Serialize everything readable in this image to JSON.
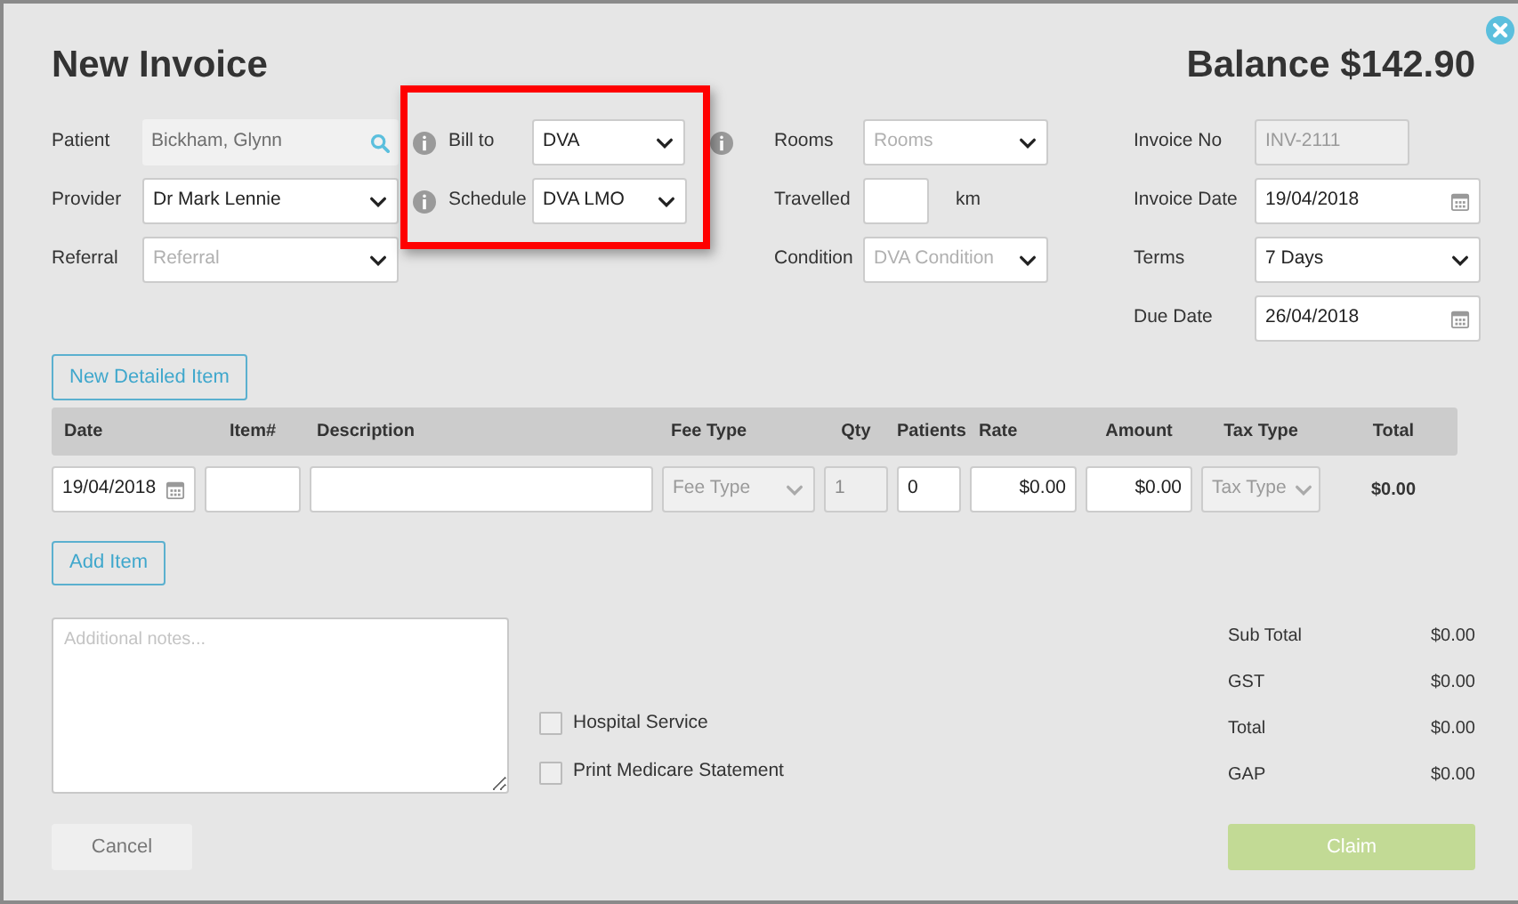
{
  "dialog": {
    "title": "New Invoice",
    "balance": "Balance $142.90"
  },
  "patient_fields": [
    {
      "kind": "search",
      "label": "Patient",
      "value": "Bickham, Glynn"
    },
    {
      "kind": "select",
      "label": "Provider",
      "value": "Dr Mark Lennie"
    },
    {
      "kind": "select",
      "label": "Referral",
      "placeholder": "Referral"
    }
  ],
  "billing_fields": [
    {
      "kind": "select",
      "label": "Bill to",
      "value": "DVA",
      "info_after": true
    },
    {
      "kind": "select",
      "label": "Schedule",
      "value": "DVA LMO",
      "info_after": false
    }
  ],
  "visit_fields": [
    {
      "kind": "select",
      "label": "Rooms",
      "placeholder": "Rooms"
    },
    {
      "kind": "number",
      "label": "Travelled",
      "unit": "km"
    },
    {
      "kind": "select",
      "label": "Condition",
      "placeholder": "DVA Condition"
    }
  ],
  "invoice_fields": [
    {
      "kind": "text",
      "label": "Invoice No",
      "placeholder": "INV-2111",
      "disabled": true
    },
    {
      "kind": "date",
      "label": "Invoice Date",
      "value": "19/04/2018"
    },
    {
      "kind": "select",
      "label": "Terms",
      "value": "7 Days"
    },
    {
      "kind": "date",
      "label": "Due Date",
      "value": "26/04/2018"
    }
  ],
  "new_detailed_item_button": "New Detailed Item",
  "line_items": {
    "columns": [
      "Date",
      "Item#",
      "Description",
      "Fee Type",
      "Qty",
      "Patients",
      "Rate",
      "Amount",
      "Tax Type",
      "Total"
    ],
    "rows": [
      {
        "cells": [
          {
            "kind": "date",
            "value": "19/04/2018"
          },
          {
            "kind": "text"
          },
          {
            "kind": "text"
          },
          {
            "kind": "select",
            "placeholder": "Fee Type",
            "disabled": true
          },
          {
            "kind": "text",
            "value": "1",
            "disabled": true
          },
          {
            "kind": "text",
            "value": "0"
          },
          {
            "kind": "money",
            "value": "$0.00"
          },
          {
            "kind": "money",
            "value": "$0.00"
          },
          {
            "kind": "select",
            "placeholder": "Tax Type",
            "disabled": true
          },
          {
            "kind": "plain",
            "value": "$0.00"
          }
        ]
      }
    ]
  },
  "add_item_button": "Add Item",
  "notes": {
    "placeholder": "Additional notes..."
  },
  "checkboxes": [
    {
      "label": "Hospital Service",
      "checked": false
    },
    {
      "label": "Print Medicare Statement",
      "checked": false
    }
  ],
  "totals": [
    {
      "label": "Sub Total",
      "value": "$0.00"
    },
    {
      "label": "GST",
      "value": "$0.00"
    },
    {
      "label": "Total",
      "value": "$0.00"
    },
    {
      "label": "GAP",
      "value": "$0.00"
    }
  ],
  "buttons": {
    "cancel": {
      "label": "Cancel"
    },
    "claim": {
      "label": "Claim",
      "disabled": true
    }
  }
}
